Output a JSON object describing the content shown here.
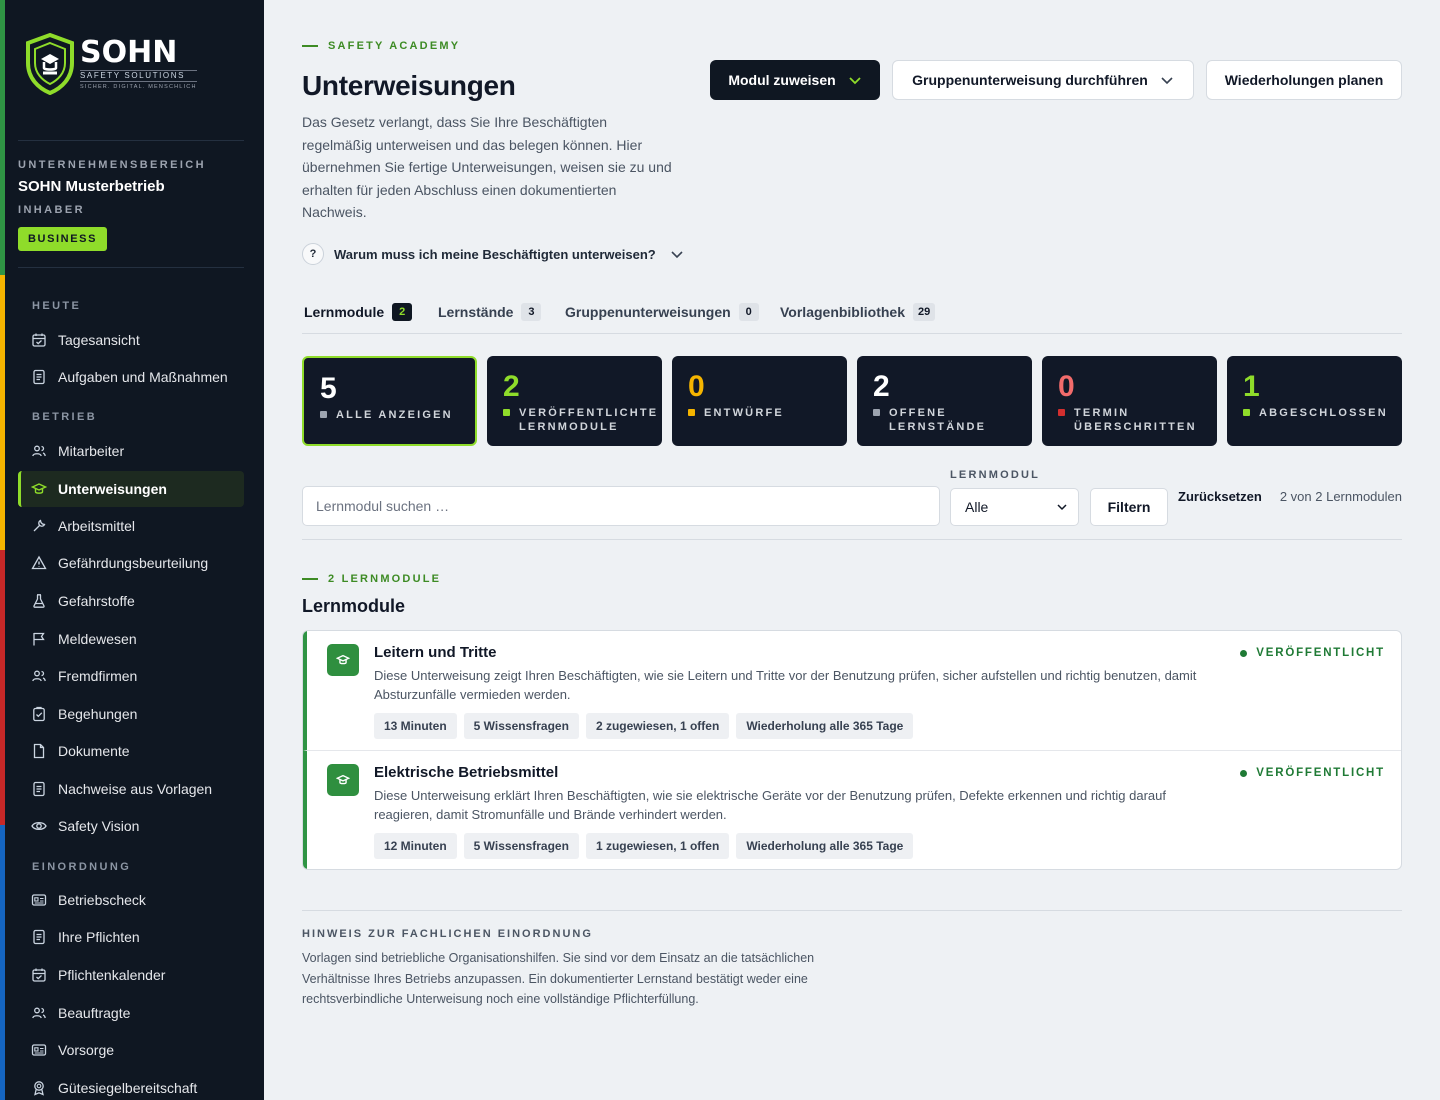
{
  "brand": {
    "name": "SOHN",
    "tagline": "SAFETY SOLUTIONS",
    "slogan": "SICHER. DIGITAL. MENSCHLICH",
    "colors": {
      "accent": "#8fdc2a",
      "sidebar": "#0f1722",
      "success": "#2f9444"
    }
  },
  "company": {
    "label": "UNTERNEHMENSBEREICH",
    "name": "SOHN Musterbetrieb",
    "role": "INHABER",
    "plan": "BUSINESS"
  },
  "sidebar": {
    "sections": [
      "HEUTE",
      "BETRIEB",
      "EINORDNUNG"
    ],
    "items": [
      {
        "label": "Tagesansicht",
        "icon": "calendar-check-icon"
      },
      {
        "label": "Aufgaben und Maßnahmen",
        "icon": "document-list-icon"
      },
      {
        "label": "Mitarbeiter",
        "icon": "users-icon"
      },
      {
        "label": "Unterweisungen",
        "icon": "graduation-cap-icon",
        "active": true
      },
      {
        "label": "Arbeitsmittel",
        "icon": "wrench-icon"
      },
      {
        "label": "Gefährdungsbeurteilung",
        "icon": "warning-triangle-icon"
      },
      {
        "label": "Gefahrstoffe",
        "icon": "flask-icon"
      },
      {
        "label": "Meldewesen",
        "icon": "flag-icon"
      },
      {
        "label": "Fremdfirmen",
        "icon": "users-icon"
      },
      {
        "label": "Begehungen",
        "icon": "clipboard-check-icon"
      },
      {
        "label": "Dokumente",
        "icon": "file-icon"
      },
      {
        "label": "Nachweise aus Vorlagen",
        "icon": "document-list-icon"
      },
      {
        "label": "Safety Vision",
        "icon": "eye-icon"
      },
      {
        "label": "Betriebscheck",
        "icon": "id-card-icon"
      },
      {
        "label": "Ihre Pflichten",
        "icon": "document-list-icon"
      },
      {
        "label": "Pflichtenkalender",
        "icon": "calendar-check-icon"
      },
      {
        "label": "Beauftragte",
        "icon": "users-icon"
      },
      {
        "label": "Vorsorge",
        "icon": "id-card-icon"
      },
      {
        "label": "Gütesiegelbereitschaft",
        "icon": "award-icon"
      }
    ]
  },
  "header": {
    "eyebrow": "SAFETY ACADEMY",
    "title": "Unterweisungen",
    "intro": "Das Gesetz verlangt, dass Sie Ihre Beschäftigten regelmäßig unterweisen und das belegen können. Hier übernehmen Sie fertige Unterweisungen, weisen sie zu und erhalten für jeden Abschluss einen dokumentierten Nachweis.",
    "faq": "Warum muss ich meine Beschäftigten unterweisen?",
    "faq_icon": "?",
    "actions": {
      "assign": "Modul zuweisen",
      "group": "Gruppenunterweisung durchführen",
      "repeat": "Wiederholungen planen"
    }
  },
  "tabs": [
    {
      "label": "Lernmodule",
      "count": "2",
      "active": true
    },
    {
      "label": "Lernstände",
      "count": "3"
    },
    {
      "label": "Gruppenunterweisungen",
      "count": "0"
    },
    {
      "label": "Vorlagenbibliothek",
      "count": "29"
    }
  ],
  "stats": [
    {
      "value": "5",
      "label": "ALLE ANZEIGEN",
      "color": "#ffffff",
      "dot": "#9ca3af",
      "active": true
    },
    {
      "value": "2",
      "label": "VERÖFFENTLICHTE LERNMODULE",
      "color": "#8fdc2a",
      "dot": "#8fdc2a"
    },
    {
      "value": "0",
      "label": "ENTWÜRFE",
      "color": "#f5b400",
      "dot": "#f5b400"
    },
    {
      "value": "2",
      "label": "OFFENE LERNSTÄNDE",
      "color": "#ffffff",
      "dot": "#9ca3af"
    },
    {
      "value": "0",
      "label": "TERMIN ÜBERSCHRITTEN",
      "color": "#f26b6b",
      "dot": "#d32f2f"
    },
    {
      "value": "1",
      "label": "ABGESCHLOSSEN",
      "color": "#8fdc2a",
      "dot": "#8fdc2a"
    }
  ],
  "filters": {
    "search_placeholder": "Lernmodul suchen …",
    "module_label": "LERNMODUL",
    "module_value": "Alle",
    "filter_button": "Filtern",
    "reset": "Zurücksetzen",
    "result_count": "2 von 2 Lernmodulen"
  },
  "list": {
    "eyebrow": "2 LERNMODULE",
    "title": "Lernmodule",
    "modules": [
      {
        "title": "Leitern und Tritte",
        "description": "Diese Unterweisung zeigt Ihren Beschäftigten, wie sie Leitern und Tritte vor der Benutzung prüfen, sicher aufstellen und richtig benutzen, damit Absturzunfälle vermieden werden.",
        "status": "VERÖFFENTLICHT",
        "tags": [
          "13 Minuten",
          "5 Wissensfragen",
          "2 zugewiesen, 1 offen",
          "Wiederholung alle 365 Tage"
        ]
      },
      {
        "title": "Elektrische Betriebsmittel",
        "description": "Diese Unterweisung erklärt Ihren Beschäftigten, wie sie elektrische Geräte vor der Benutzung prüfen, Defekte erkennen und richtig darauf reagieren, damit Stromunfälle und Brände verhindert werden.",
        "status": "VERÖFFENTLICHT",
        "tags": [
          "12 Minuten",
          "5 Wissensfragen",
          "1 zugewiesen, 1 offen",
          "Wiederholung alle 365 Tage"
        ]
      }
    ]
  },
  "note": {
    "label": "HINWEIS ZUR FACHLICHEN EINORDNUNG",
    "text": "Vorlagen sind betriebliche Organisationshilfen. Sie sind vor dem Einsatz an die tatsächlichen Verhältnisse Ihres Betriebs anzupassen. Ein dokumentierter Lernstand bestätigt weder eine rechtsverbindliche Unterweisung noch eine vollständige Pflichterfüllung."
  }
}
